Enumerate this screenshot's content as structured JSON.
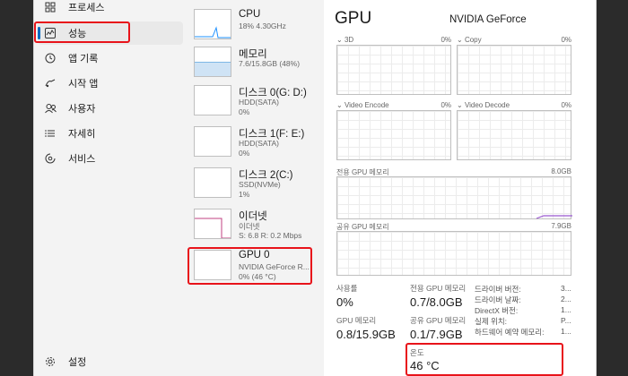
{
  "sidebar": {
    "items": [
      {
        "label": "프로세스",
        "icon": "process-icon"
      },
      {
        "label": "성능",
        "icon": "performance-icon"
      },
      {
        "label": "앱 기록",
        "icon": "history-icon"
      },
      {
        "label": "시작 앱",
        "icon": "startup-icon"
      },
      {
        "label": "사용자",
        "icon": "users-icon"
      },
      {
        "label": "자세히",
        "icon": "details-icon"
      },
      {
        "label": "서비스",
        "icon": "services-icon"
      }
    ],
    "settings": {
      "label": "설정",
      "icon": "gear-icon"
    }
  },
  "devices": [
    {
      "name": "CPU",
      "sub1": "18% 4.30GHz",
      "sub2": ""
    },
    {
      "name": "메모리",
      "sub1": "7.6/15.8GB (48%)",
      "sub2": ""
    },
    {
      "name": "디스크 0(G: D:)",
      "sub1": "HDD(SATA)",
      "sub2": "0%"
    },
    {
      "name": "디스크 1(F: E:)",
      "sub1": "HDD(SATA)",
      "sub2": "0%"
    },
    {
      "name": "디스크 2(C:)",
      "sub1": "SSD(NVMe)",
      "sub2": "1%"
    },
    {
      "name": "이더넷",
      "sub1": "이더넷",
      "sub2": "S: 6.8 R: 0.2 Mbps"
    },
    {
      "name": "GPU 0",
      "sub1": "NVIDIA GeForce R...",
      "sub2": "0% (46 °C)"
    }
  ],
  "main": {
    "title": "GPU",
    "model": "NVIDIA GeForce",
    "engines": [
      {
        "label": "3D",
        "pct": "0%"
      },
      {
        "label": "Copy",
        "pct": "0%"
      },
      {
        "label": "Video Encode",
        "pct": "0%"
      },
      {
        "label": "Video Decode",
        "pct": "0%"
      }
    ],
    "dedicated": {
      "label": "전용 GPU 메모리",
      "max": "8.0GB"
    },
    "shared": {
      "label": "공유 GPU 메모리",
      "max": "7.9GB"
    },
    "stats": {
      "utilization_label": "사용률",
      "utilization_value": "0%",
      "dedicated_label": "전용 GPU 메모리",
      "dedicated_value": "0.7/8.0GB",
      "gpu_mem_label": "GPU 메모리",
      "gpu_mem_value": "0.8/15.9GB",
      "shared_label": "공유 GPU 메모리",
      "shared_value": "0.1/7.9GB",
      "temp_label": "온도",
      "temp_value": "46 °C"
    },
    "props": [
      {
        "k": "드라이버 버전:",
        "v": "3..."
      },
      {
        "k": "드라이버 날짜:",
        "v": "2..."
      },
      {
        "k": "DirectX 버전:",
        "v": "1..."
      },
      {
        "k": "실제 위치:",
        "v": "P..."
      },
      {
        "k": "하드웨어 예약 메모리:",
        "v": "1..."
      }
    ]
  },
  "colors": {
    "highlight": "#e8131a",
    "accent": "#0067c0",
    "cpu_line": "#1e90ff",
    "memory_fill": "#7eb8e6",
    "ethernet_line": "#c04080",
    "gpu_mem_line": "#9b59d0"
  }
}
